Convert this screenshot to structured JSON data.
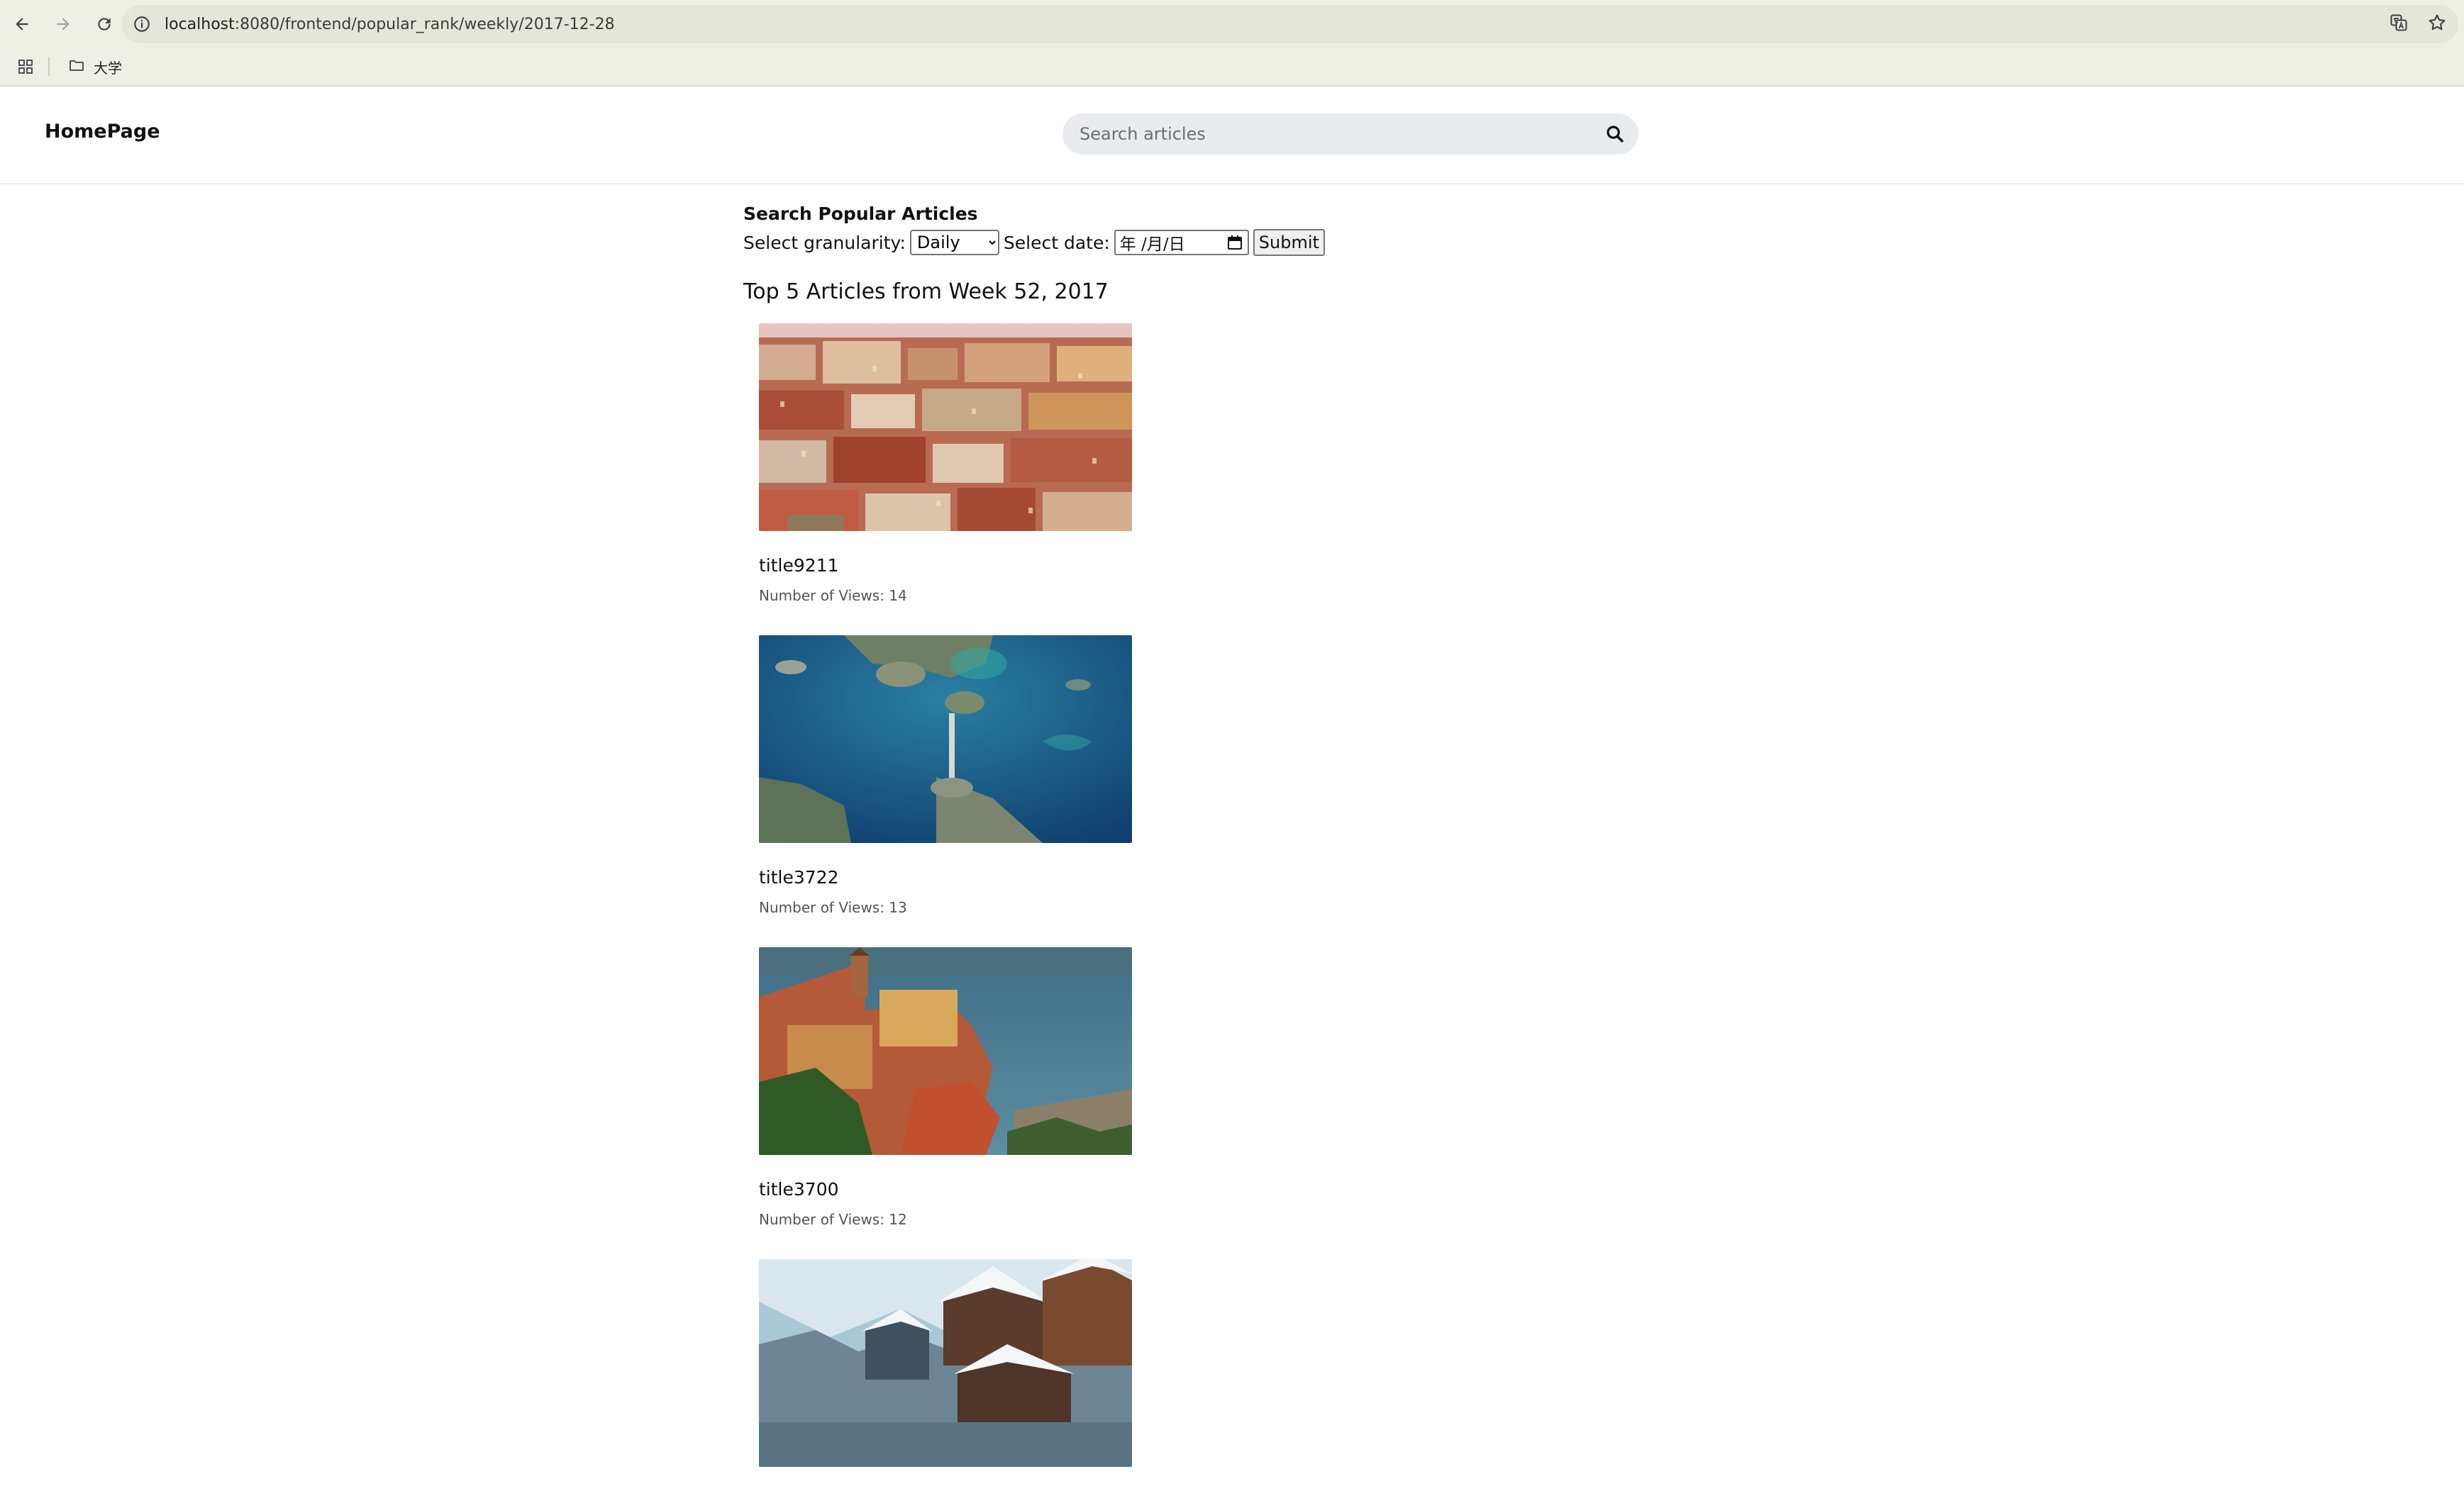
{
  "browser": {
    "url_host": "localhost",
    "url_path": ":8080/frontend/popular_rank/weekly/2017-12-28",
    "bookmark_folder": "大学"
  },
  "site": {
    "brand": "HomePage",
    "search_placeholder": "Search articles"
  },
  "form": {
    "heading": "Search Popular Articles",
    "granularity_label": "Select granularity:",
    "granularity_value": "Daily",
    "date_label": "Select date:",
    "date_placeholder": "年 /月/日",
    "submit_label": "Submit"
  },
  "results": {
    "title": "Top 5 Articles from Week 52, 2017",
    "articles": [
      {
        "title": "title9211",
        "views": "Number of Views: 14"
      },
      {
        "title": "title3722",
        "views": "Number of Views: 13"
      },
      {
        "title": "title3700",
        "views": "Number of Views: 12"
      },
      {
        "title": "",
        "views": ""
      }
    ]
  },
  "colors": {
    "chrome_bg": "#eef0e6",
    "omnibox_bg": "#e3e6d8",
    "search_bg": "#e9ecee"
  }
}
